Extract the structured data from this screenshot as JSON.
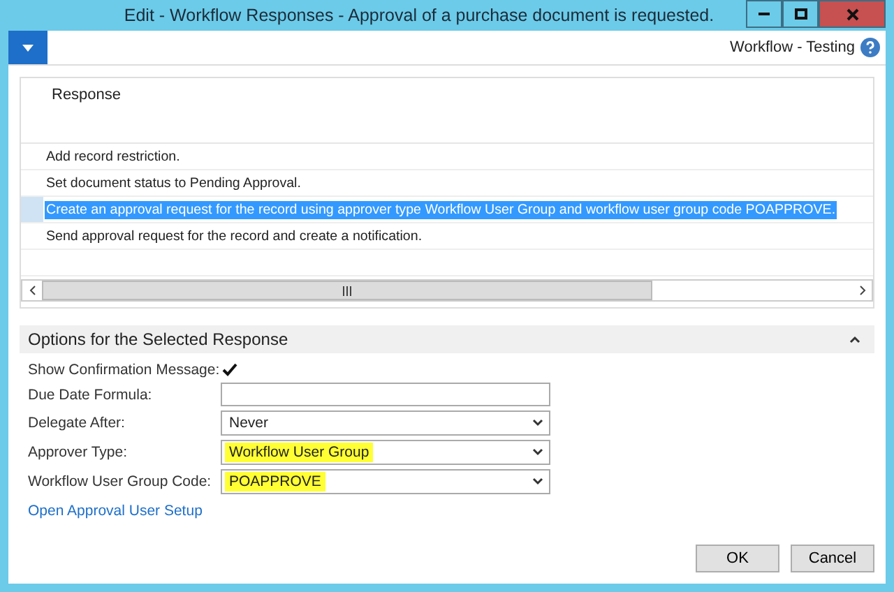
{
  "window": {
    "title": "Edit - Workflow Responses - Approval of a purchase document is requested."
  },
  "toolbar": {
    "context": "Workflow - Testing"
  },
  "table": {
    "columns": [
      "Response"
    ],
    "rows": [
      {
        "text": "Add record restriction.",
        "selected": false
      },
      {
        "text": "Set document status to Pending Approval.",
        "selected": false
      },
      {
        "text": "Create an approval request for the record using approver type Workflow User Group and workflow user group code POAPPROVE.",
        "selected": true
      },
      {
        "text": "Send approval request for the record and create a notification.",
        "selected": false
      }
    ]
  },
  "options": {
    "title": "Options for the Selected Response",
    "expanded": true,
    "fields": [
      {
        "kind": "checkbox",
        "label": "Show Confirmation Message:",
        "checked": true
      },
      {
        "kind": "text",
        "label": "Due Date Formula:"
      },
      {
        "kind": "select",
        "label": "Delegate After:",
        "value": "Never",
        "highlighted": false
      },
      {
        "kind": "select",
        "label": "Approver Type:",
        "value": "Workflow User Group",
        "highlighted": true
      },
      {
        "kind": "select",
        "label": "Workflow User Group Code:",
        "value": "POAPPROVE",
        "highlighted": true
      }
    ],
    "link": "Open Approval User Setup"
  },
  "buttons": [
    "OK",
    "Cancel"
  ]
}
